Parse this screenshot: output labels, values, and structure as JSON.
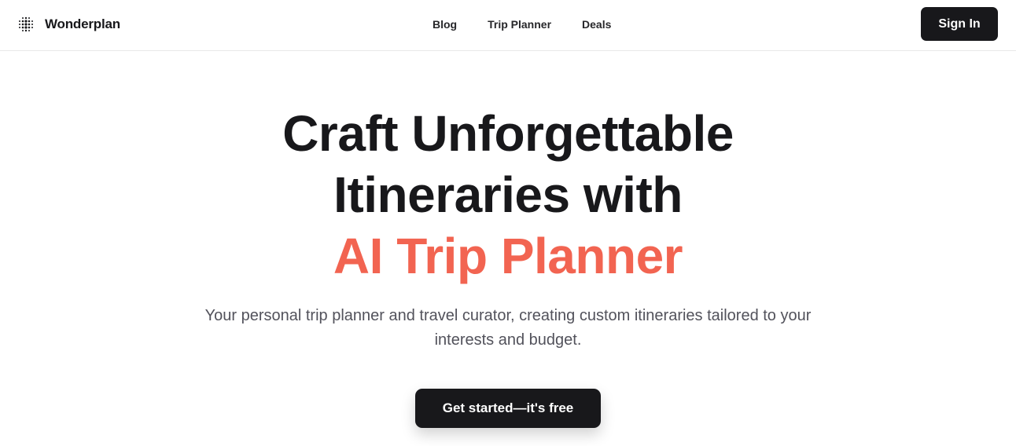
{
  "header": {
    "brand_name": "Wonderplan",
    "logo_icon": "dot-matrix-logo-icon",
    "nav": [
      {
        "label": "Blog"
      },
      {
        "label": "Trip Planner"
      },
      {
        "label": "Deals"
      }
    ],
    "sign_in_label": "Sign In"
  },
  "hero": {
    "headline_line1": "Craft Unforgettable",
    "headline_line2": "Itineraries with",
    "headline_accent": "AI Trip Planner",
    "subtitle": "Your personal trip planner and travel curator, creating custom itineraries tailored to your interests and budget.",
    "cta_label": "Get started—it's free"
  },
  "colors": {
    "accent": "#f26451",
    "dark": "#18181b",
    "muted_text": "#52525b",
    "background": "#ffffff"
  }
}
